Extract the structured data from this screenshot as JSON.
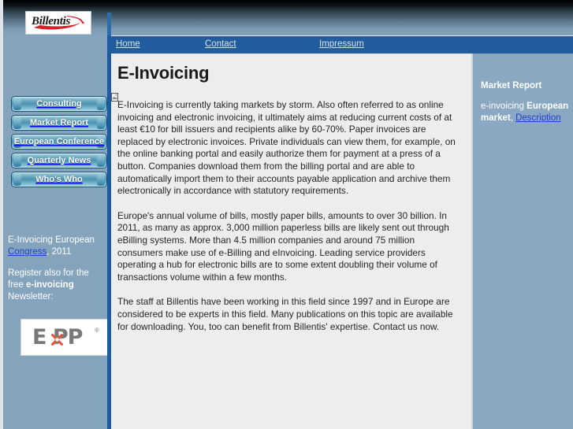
{
  "site": {
    "logo_text": "Billentis",
    "logo_icon": "billentis-swoosh-logo"
  },
  "topnav": {
    "items": [
      {
        "label": "Home"
      },
      {
        "label": "Contact"
      },
      {
        "label": "Impressum"
      }
    ]
  },
  "sidebar_left": {
    "buttons": [
      {
        "label": "Consulting"
      },
      {
        "label": "Market Report"
      },
      {
        "label": "European Conference"
      },
      {
        "label": "Quarterly News"
      },
      {
        "label": "Who's Who"
      }
    ],
    "promo_congress": {
      "lead": "E-Invoicing  European ",
      "link": "Congress",
      "trail": ", 2011"
    },
    "promo_newsletter": {
      "line1": "Register also for the",
      "line2_prefix": "free ",
      "line2_bold": "e-invoicing",
      "line3": "Newsletter:"
    },
    "partner_logo": {
      "mark": "ExPP",
      "mark_prefix": "E",
      "mark_suffix": "PP",
      "registered": "®",
      "icon": "expp-x-logo"
    }
  },
  "main": {
    "title": "E-Invoicing",
    "paragraphs": [
      "E-Invoicing is currently taking markets by storm. Also often referred to as online invoicing and electronic invoicing, it ultimately aims at reducing current costs of at least €10 for bill issuers and recipients alike by 60-70%. Paper invoices are replaced by electronic invoices. Private individuals can view them, for example, on the online banking portal and easily authorize them for payment at a press of a button. Companies download them from the billing portal and are able to automatically import them to their accounts payable application and archive them electronically in accordance with statutory requirements.",
      "Europe's annual volume of bills, mostly paper bills, amounts to over 30 billion. In 2011, as many as approx. 3,000 million paperless bills are likely sent out through eBilling systems. More than 4.5 million companies and around 75 million consumers make use of e-Billing and eInvoicing. Leading service providers operating a hub for electronic bills are to some extent doubling their volume of transactions volume within a few months.",
      "The staff at Billentis have been working in this field since 1997 and in Europe are considered to be experts in this field. Many publications on this topic are available for downloading. You, too can benefit from Billentis' expertise. Contact us now."
    ]
  },
  "sidebar_right": {
    "title": "Market Report",
    "body": {
      "prefix": "e-invoicing ",
      "bold": "European market",
      "middle": ", ",
      "link": "Description"
    }
  },
  "colors": {
    "header_gradient_top": "#000000",
    "steel_blue": "#84a3bd",
    "nav_bar_blue": "#215c9c",
    "divider_blue": "#1d5ca0",
    "content_bg": "#ededed",
    "link_blue": "#1d3fd6",
    "logo_red": "#d81e26",
    "expp_gray": "#77797b",
    "expp_orange": "#e2553a"
  }
}
